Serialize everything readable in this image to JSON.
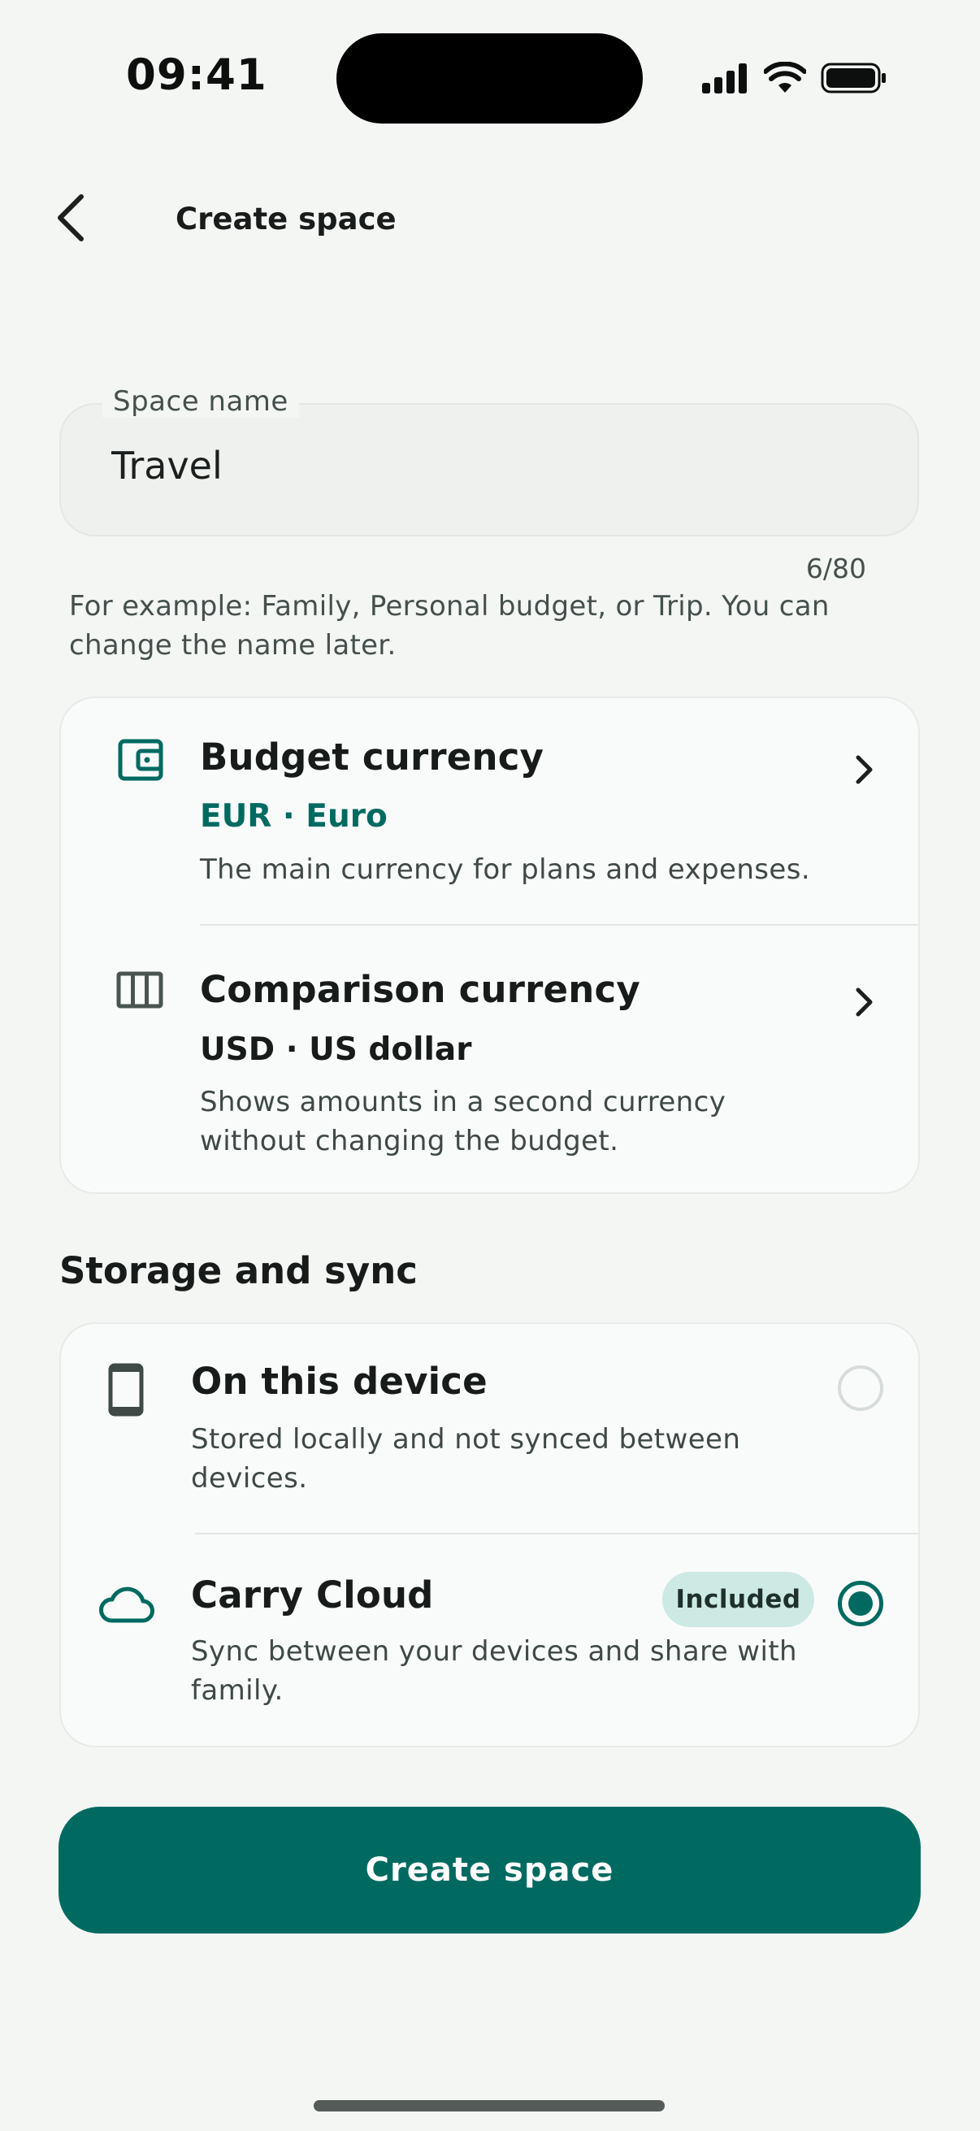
{
  "status_bar": {
    "time": "09:41"
  },
  "header": {
    "title": "Create space"
  },
  "space_name": {
    "label": "Space name",
    "value": "Travel",
    "counter": "6/80",
    "helper": "For example: Family, Personal budget, or Trip. You can change the name later."
  },
  "currency": {
    "budget": {
      "title": "Budget currency",
      "value": "EUR · Euro",
      "description": "The main currency for plans and expenses."
    },
    "comparison": {
      "title": "Comparison currency",
      "value": "USD · US dollar",
      "description": "Shows amounts in a second currency without changing the budget."
    }
  },
  "storage": {
    "section_title": "Storage and sync",
    "options": [
      {
        "title": "On this device",
        "description": "Stored locally and not synced between devices.",
        "selected": false
      },
      {
        "title": "Carry Cloud",
        "badge": "Included",
        "description": "Sync between your devices and share with family.",
        "selected": true
      }
    ]
  },
  "actions": {
    "create_label": "Create space"
  },
  "colors": {
    "accent": "#006a61",
    "background": "#f4f6f4",
    "badge_bg": "#cde9e3"
  }
}
